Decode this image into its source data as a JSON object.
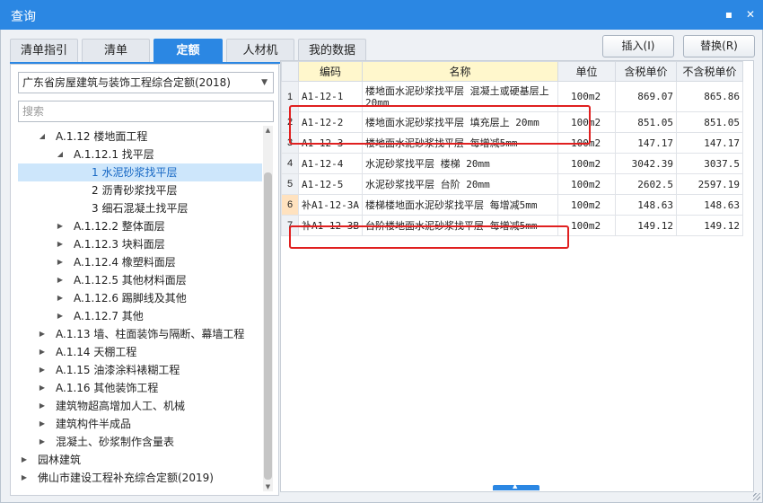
{
  "window": {
    "title": "查询",
    "minimize_icon": "minimize-icon",
    "close_icon": "close-icon"
  },
  "tabs": [
    {
      "label": "清单指引"
    },
    {
      "label": "清单"
    },
    {
      "label": "定额"
    },
    {
      "label": "人材机"
    },
    {
      "label": "我的数据"
    }
  ],
  "active_tab": "定额",
  "actions": {
    "insert": "插入(I)",
    "replace": "替换(R)"
  },
  "library_select": {
    "value": "广东省房屋建筑与装饰工程综合定额(2018)"
  },
  "search": {
    "placeholder": "搜索"
  },
  "tree": [
    {
      "label": "A.1.12 楼地面工程",
      "expanded": true
    },
    {
      "label": "A.1.12.1 找平层",
      "expanded": true
    },
    {
      "label": "1 水泥砂浆找平层",
      "selected": true
    },
    {
      "label": "2 沥青砂浆找平层"
    },
    {
      "label": "3 细石混凝土找平层"
    },
    {
      "label": "A.1.12.2 整体面层"
    },
    {
      "label": "A.1.12.3 块料面层"
    },
    {
      "label": "A.1.12.4 橡塑料面层"
    },
    {
      "label": "A.1.12.5 其他材料面层"
    },
    {
      "label": "A.1.12.6 踢脚线及其他"
    },
    {
      "label": "A.1.12.7 其他"
    },
    {
      "label": "A.1.13 墙、柱面装饰与隔断、幕墙工程"
    },
    {
      "label": "A.1.14 天棚工程"
    },
    {
      "label": "A.1.15 油漆涂料裱糊工程"
    },
    {
      "label": "A.1.16 其他装饰工程"
    },
    {
      "label": "建筑物超高增加人工、机械"
    },
    {
      "label": "建筑构件半成品"
    },
    {
      "label": "混凝土、砂浆制作含量表"
    },
    {
      "label": "园林建筑"
    },
    {
      "label": "佛山市建设工程补充综合定额(2019)"
    }
  ],
  "table": {
    "headers": [
      "",
      "编码",
      "名称",
      "单位",
      "含税单价",
      "不含税单价"
    ],
    "rows": [
      {
        "idx": "1",
        "code": "A1-12-1",
        "name": "楼地面水泥砂浆找平层 混凝土或硬基层上 20mm",
        "unit": "100m2",
        "price_tax": "869.07",
        "price_notax": "865.86"
      },
      {
        "idx": "2",
        "code": "A1-12-2",
        "name": "楼地面水泥砂浆找平层 填充层上 20mm",
        "unit": "100m2",
        "price_tax": "851.05",
        "price_notax": "851.05"
      },
      {
        "idx": "3",
        "code": "A1-12-3",
        "name": "楼地面水泥砂浆找平层 每增减5mm",
        "unit": "100m2",
        "price_tax": "147.17",
        "price_notax": "147.17"
      },
      {
        "idx": "4",
        "code": "A1-12-4",
        "name": "水泥砂浆找平层 楼梯 20mm",
        "unit": "100m2",
        "price_tax": "3042.39",
        "price_notax": "3037.5"
      },
      {
        "idx": "5",
        "code": "A1-12-5",
        "name": "水泥砂浆找平层 台阶 20mm",
        "unit": "100m2",
        "price_tax": "2602.5",
        "price_notax": "2597.19"
      },
      {
        "idx": "6",
        "code": "补A1-12-3A",
        "name": "楼梯楼地面水泥砂浆找平层 每增减5mm",
        "unit": "100m2",
        "price_tax": "148.63",
        "price_notax": "148.63"
      },
      {
        "idx": "7",
        "code": "补A1-12-3B",
        "name": "台阶楼地面水泥砂浆找平层 每增减5mm",
        "unit": "100m2",
        "price_tax": "149.12",
        "price_notax": "149.12"
      }
    ]
  },
  "colors": {
    "accent": "#2b87e3",
    "highlight_box": "#e02020",
    "selection": "#cde6fb"
  }
}
